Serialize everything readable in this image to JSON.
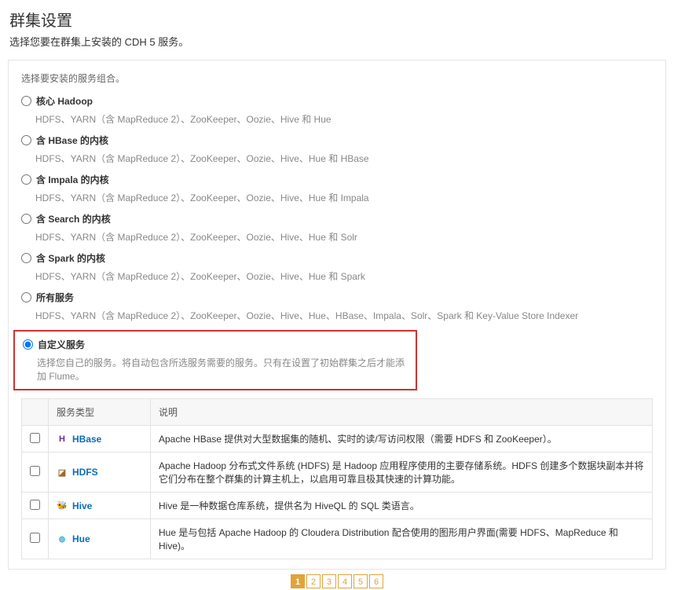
{
  "pageTitle": "群集设置",
  "pageSubtitle": "选择您要在群集上安装的 CDH 5 服务。",
  "panelHint": "选择要安装的服务组合。",
  "options": [
    {
      "id": "core-hadoop",
      "title": "核心 Hadoop",
      "desc": "HDFS、YARN（含 MapReduce 2）、ZooKeeper、Oozie、Hive 和 Hue",
      "selected": false
    },
    {
      "id": "with-hbase",
      "title": "含 HBase 的内核",
      "desc": "HDFS、YARN（含 MapReduce 2）、ZooKeeper、Oozie、Hive、Hue 和 HBase",
      "selected": false
    },
    {
      "id": "with-impala",
      "title": "含 Impala 的内核",
      "desc": "HDFS、YARN（含 MapReduce 2）、ZooKeeper、Oozie、Hive、Hue 和 Impala",
      "selected": false
    },
    {
      "id": "with-search",
      "title": "含 Search 的内核",
      "desc": "HDFS、YARN（含 MapReduce 2）、ZooKeeper、Oozie、Hive、Hue 和 Solr",
      "selected": false
    },
    {
      "id": "with-spark",
      "title": "含 Spark 的内核",
      "desc": "HDFS、YARN（含 MapReduce 2）、ZooKeeper、Oozie、Hive、Hue 和 Spark",
      "selected": false
    },
    {
      "id": "all-services",
      "title": "所有服务",
      "desc": "HDFS、YARN（含 MapReduce 2）、ZooKeeper、Oozie、Hive、Hue、HBase、Impala、Solr、Spark 和 Key-Value Store Indexer",
      "selected": false
    },
    {
      "id": "custom",
      "title": "自定义服务",
      "desc": "选择您自己的服务。将自动包含所选服务需要的服务。只有在设置了初始群集之后才能添加 Flume。",
      "selected": true
    }
  ],
  "table": {
    "headers": {
      "check": "",
      "type": "服务类型",
      "desc": "说明"
    },
    "rows": [
      {
        "id": "hbase",
        "icon": "H",
        "iconClass": "icon-hbase",
        "name": "HBase",
        "desc": "Apache HBase 提供对大型数据集的随机、实时的读/写访问权限（需要 HDFS 和 ZooKeeper）。"
      },
      {
        "id": "hdfs",
        "icon": "◪",
        "iconClass": "icon-hdfs",
        "name": "HDFS",
        "desc": "Apache Hadoop 分布式文件系统 (HDFS) 是 Hadoop 应用程序使用的主要存储系统。HDFS 创建多个数据块副本并将它们分布在整个群集的计算主机上，以启用可靠且极其快速的计算功能。"
      },
      {
        "id": "hive",
        "icon": "🐝",
        "iconClass": "icon-hive",
        "name": "Hive",
        "desc": "Hive 是一种数据仓库系统，提供名为 HiveQL 的 SQL 类语言。"
      },
      {
        "id": "hue",
        "icon": "⊚",
        "iconClass": "icon-hue",
        "name": "Hue",
        "desc": "Hue 是与包括 Apache Hadoop 的 Cloudera Distribution 配合使用的图形用户界面(需要 HDFS、MapReduce 和 Hive)。"
      }
    ]
  },
  "pager": {
    "current": 1,
    "total": 6
  }
}
